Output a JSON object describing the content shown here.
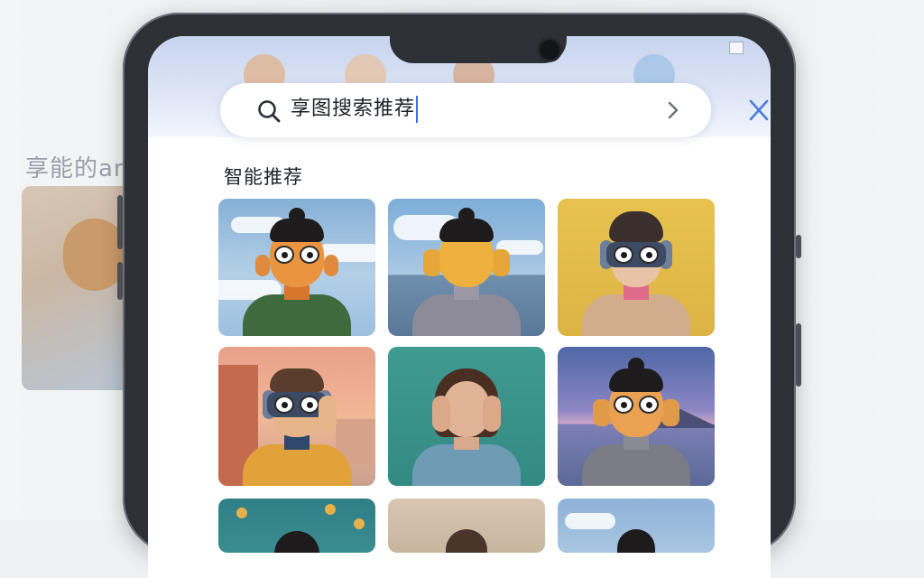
{
  "background_app": {
    "title": "享能的am"
  },
  "search": {
    "query": "享图搜索推荐"
  },
  "section": {
    "title": "智能推荐"
  },
  "colors": {
    "accent_caret": "#3c6df0",
    "close_x": "#4c7bd9",
    "notification_dot": "#e24a4a"
  },
  "icons": {
    "search": "search-icon",
    "chevron": "chevron-right-icon",
    "close": "close-icon"
  },
  "recommendations": [
    {
      "id": "card-1",
      "style": "sky-clouds, orange-face character, green hoodie"
    },
    {
      "id": "card-2",
      "style": "sea-horizon, grumpy yellow face, grey hoodie"
    },
    {
      "id": "card-3",
      "style": "yellow wall, goggles, beige jacket"
    },
    {
      "id": "card-4",
      "style": "sunset city, goggles, mustard shirt"
    },
    {
      "id": "card-5",
      "style": "teal wall, woman hands on face"
    },
    {
      "id": "card-6",
      "style": "lake mountains dusk, orange-face character"
    },
    {
      "id": "card-7",
      "style": "partial row"
    },
    {
      "id": "card-8",
      "style": "partial row"
    },
    {
      "id": "card-9",
      "style": "partial row"
    }
  ]
}
